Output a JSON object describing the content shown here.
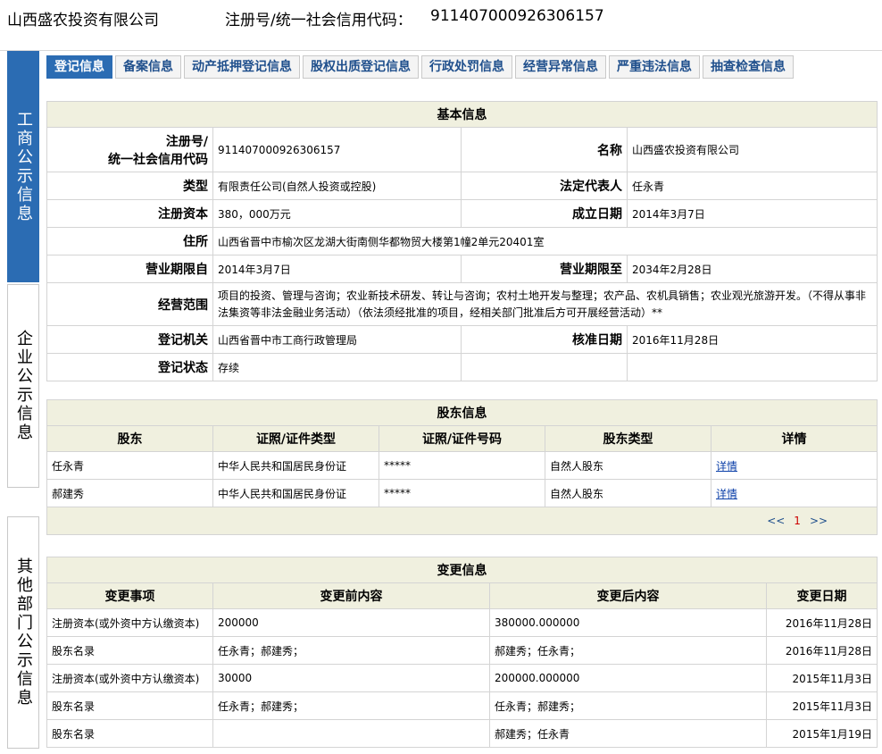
{
  "header": {
    "company_name": "山西盛农投资有限公司",
    "reg_label": "注册号/统一社会信用代码：",
    "reg_value": "911407000926306157"
  },
  "sidebar": {
    "items": [
      {
        "label": "工商公示信息",
        "active": true
      },
      {
        "label": "企业公示信息",
        "active": false
      },
      {
        "label": "其他部门公示信息",
        "active": false
      }
    ]
  },
  "tabs": [
    {
      "label": "登记信息",
      "active": true
    },
    {
      "label": "备案信息"
    },
    {
      "label": "动产抵押登记信息"
    },
    {
      "label": "股权出质登记信息"
    },
    {
      "label": "行政处罚信息"
    },
    {
      "label": "经营异常信息"
    },
    {
      "label": "严重违法信息"
    },
    {
      "label": "抽查检查信息"
    }
  ],
  "basic": {
    "title": "基本信息",
    "reg_no_label_1": "注册号/",
    "reg_no_label_2": "统一社会信用代码",
    "reg_no": "911407000926306157",
    "name_label": "名称",
    "name": "山西盛农投资有限公司",
    "type_label": "类型",
    "type": "有限责任公司(自然人投资或控股)",
    "legal_rep_label": "法定代表人",
    "legal_rep": "任永青",
    "capital_label": "注册资本",
    "capital": "380，000万元",
    "est_date_label": "成立日期",
    "est_date": "2014年3月7日",
    "address_label": "住所",
    "address": "山西省晋中市榆次区龙湖大街南侧华都物贸大楼第1幢2单元20401室",
    "term_from_label": "营业期限自",
    "term_from": "2014年3月7日",
    "term_to_label": "营业期限至",
    "term_to": "2034年2月28日",
    "scope_label": "经营范围",
    "scope": "项目的投资、管理与咨询；农业新技术研发、转让与咨询；农村土地开发与整理；农产品、农机具销售；农业观光旅游开发。（不得从事非法集资等非法金融业务活动）（依法须经批准的项目，经相关部门批准后方可开展经营活动）**",
    "authority_label": "登记机关",
    "authority": "山西省晋中市工商行政管理局",
    "approval_date_label": "核准日期",
    "approval_date": "2016年11月28日",
    "status_label": "登记状态",
    "status": "存续"
  },
  "shareholders": {
    "title": "股东信息",
    "columns": [
      "股东",
      "证照/证件类型",
      "证照/证件号码",
      "股东类型",
      "详情"
    ],
    "rows": [
      [
        "任永青",
        "中华人民共和国居民身份证",
        "*****",
        "自然人股东",
        "详情"
      ],
      [
        "郝建秀",
        "中华人民共和国居民身份证",
        "*****",
        "自然人股东",
        "详情"
      ]
    ],
    "pager": {
      "prev": "<<",
      "page": "1",
      "next": ">>"
    }
  },
  "changes": {
    "title": "变更信息",
    "columns": [
      "变更事项",
      "变更前内容",
      "变更后内容",
      "变更日期"
    ],
    "rows": [
      [
        "注册资本(或外资中方认缴资本)",
        "200000",
        "380000.000000",
        "2016年11月28日"
      ],
      [
        "股东名录",
        "任永青；郝建秀；",
        "郝建秀；任永青；",
        "2016年11月28日"
      ],
      [
        "注册资本(或外资中方认缴资本)",
        "30000",
        "200000.000000",
        "2015年11月3日"
      ],
      [
        "股东名录",
        "任永青；郝建秀；",
        "任永青；郝建秀；",
        "2015年11月3日"
      ],
      [
        "股东名录",
        "",
        "郝建秀；任永青",
        "2015年1月19日"
      ]
    ]
  }
}
